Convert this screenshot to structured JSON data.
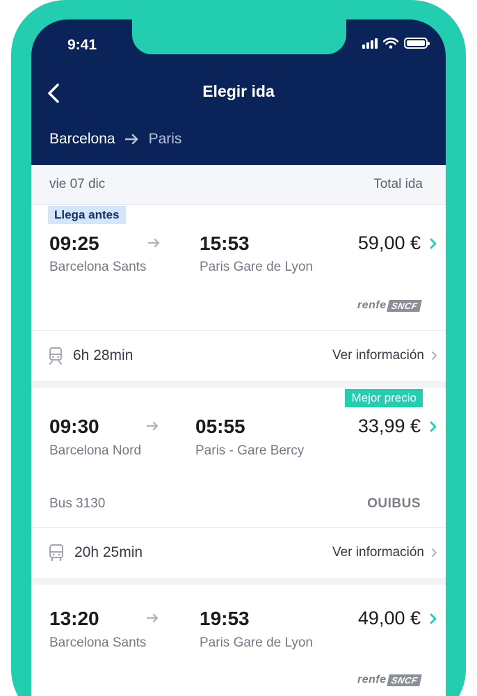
{
  "status_bar": {
    "time": "9:41"
  },
  "header": {
    "title": "Elegir ida",
    "route_from": "Barcelona",
    "route_to": "Paris"
  },
  "subheader": {
    "date": "vie 07 dic",
    "total_label": "Total ida"
  },
  "results": [
    {
      "badge": "Llega antes",
      "departure_time": "09:25",
      "departure_station": "Barcelona Sants",
      "arrival_time": "15:53",
      "arrival_station": "Paris Gare de Lyon",
      "price": "59,00 €",
      "operator_renfe": "renfe",
      "operator_sncf": "SNCF",
      "duration": "6h 28min",
      "info_link": "Ver información"
    },
    {
      "badge": "Mejor precio",
      "departure_time": "09:30",
      "departure_station": "Barcelona Nord",
      "arrival_time": "05:55",
      "arrival_station": "Paris - Gare Bercy",
      "price": "33,99 €",
      "bus_number": "Bus 3130",
      "operator": "OUIBUS",
      "duration": "20h 25min",
      "info_link": "Ver información"
    },
    {
      "departure_time": "13:20",
      "departure_station": "Barcelona Sants",
      "arrival_time": "19:53",
      "arrival_station": "Paris Gare de Lyon",
      "price": "49,00 €",
      "operator_renfe": "renfe",
      "operator_sncf": "SNCF"
    }
  ]
}
